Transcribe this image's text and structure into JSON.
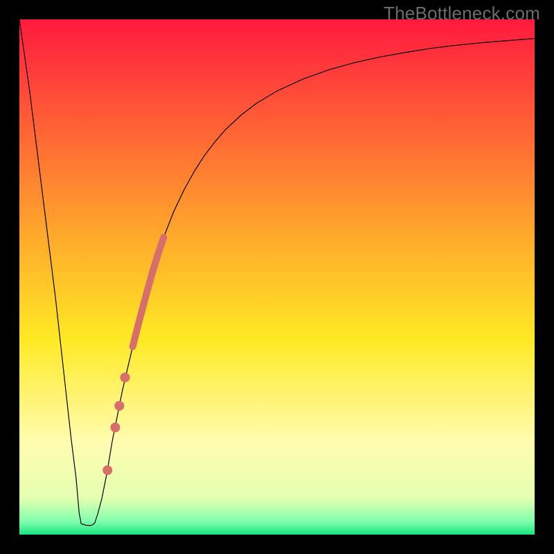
{
  "watermark": "TheBottleneck.com",
  "chart_data": {
    "type": "line",
    "title": "",
    "xlabel": "",
    "ylabel": "",
    "xlim": [
      0,
      100
    ],
    "ylim": [
      0,
      100
    ],
    "grid": false,
    "background_gradient": {
      "stops": [
        {
          "offset": 0.0,
          "color": "#ff1a3f"
        },
        {
          "offset": 0.4,
          "color": "#ffa22c"
        },
        {
          "offset": 0.62,
          "color": "#ffe924"
        },
        {
          "offset": 0.82,
          "color": "#fffcb0"
        },
        {
          "offset": 0.93,
          "color": "#e4ffb0"
        },
        {
          "offset": 0.975,
          "color": "#7dffad"
        },
        {
          "offset": 1.0,
          "color": "#16e47f"
        }
      ]
    },
    "series": [
      {
        "name": "baseline",
        "type": "line",
        "color": "#000000",
        "width": 1.2,
        "points": [
          {
            "x": 0.0,
            "y": 100.0
          },
          {
            "x": 1.0,
            "y": 93.0
          },
          {
            "x": 2.0,
            "y": 86.0
          },
          {
            "x": 3.0,
            "y": 78.0
          },
          {
            "x": 4.0,
            "y": 70.0
          },
          {
            "x": 5.0,
            "y": 62.0
          },
          {
            "x": 6.0,
            "y": 54.0
          },
          {
            "x": 7.0,
            "y": 46.0
          },
          {
            "x": 8.0,
            "y": 37.0
          },
          {
            "x": 9.0,
            "y": 28.0
          },
          {
            "x": 10.0,
            "y": 19.0
          },
          {
            "x": 11.0,
            "y": 11.0
          },
          {
            "x": 11.6,
            "y": 4.2
          },
          {
            "x": 12.0,
            "y": 2.1
          },
          {
            "x": 13.0,
            "y": 1.8
          },
          {
            "x": 14.0,
            "y": 1.8
          },
          {
            "x": 14.6,
            "y": 2.2
          },
          {
            "x": 15.2,
            "y": 4.0
          },
          {
            "x": 16.0,
            "y": 7.0
          },
          {
            "x": 17.0,
            "y": 12.0
          },
          {
            "x": 18.0,
            "y": 18.0
          },
          {
            "x": 19.0,
            "y": 23.0
          },
          {
            "x": 20.0,
            "y": 28.0
          },
          {
            "x": 21.0,
            "y": 32.3
          },
          {
            "x": 22.0,
            "y": 36.5
          },
          {
            "x": 23.0,
            "y": 40.5
          },
          {
            "x": 24.0,
            "y": 44.3
          },
          {
            "x": 25.0,
            "y": 48.0
          },
          {
            "x": 26.0,
            "y": 51.5
          },
          {
            "x": 27.0,
            "y": 54.7
          },
          {
            "x": 28.0,
            "y": 57.7
          },
          {
            "x": 30.0,
            "y": 62.8
          },
          {
            "x": 32.0,
            "y": 67.0
          },
          {
            "x": 34.0,
            "y": 70.6
          },
          {
            "x": 36.0,
            "y": 73.7
          },
          {
            "x": 38.0,
            "y": 76.3
          },
          {
            "x": 40.0,
            "y": 78.6
          },
          {
            "x": 43.0,
            "y": 81.4
          },
          {
            "x": 46.0,
            "y": 83.7
          },
          {
            "x": 50.0,
            "y": 86.1
          },
          {
            "x": 55.0,
            "y": 88.4
          },
          {
            "x": 60.0,
            "y": 90.2
          },
          {
            "x": 65.0,
            "y": 91.6
          },
          {
            "x": 70.0,
            "y": 92.7
          },
          {
            "x": 75.0,
            "y": 93.6
          },
          {
            "x": 80.0,
            "y": 94.4
          },
          {
            "x": 85.0,
            "y": 95.0
          },
          {
            "x": 90.0,
            "y": 95.5
          },
          {
            "x": 95.0,
            "y": 95.9
          },
          {
            "x": 100.0,
            "y": 96.3
          }
        ]
      },
      {
        "name": "highlight-band",
        "type": "line",
        "color": "#d76e6a",
        "width": 10,
        "linecap": "round",
        "points": [
          {
            "x": 22.0,
            "y": 36.5
          },
          {
            "x": 23.0,
            "y": 40.5
          },
          {
            "x": 24.0,
            "y": 44.3
          },
          {
            "x": 25.0,
            "y": 48.0
          },
          {
            "x": 26.0,
            "y": 51.5
          },
          {
            "x": 27.0,
            "y": 54.7
          },
          {
            "x": 28.0,
            "y": 57.7
          }
        ]
      },
      {
        "name": "dots",
        "type": "scatter",
        "color": "#d76e6a",
        "radius": 7,
        "points": [
          {
            "x": 17.1,
            "y": 12.5
          },
          {
            "x": 18.6,
            "y": 20.8
          },
          {
            "x": 19.4,
            "y": 25.0
          },
          {
            "x": 20.5,
            "y": 30.5
          }
        ]
      }
    ]
  }
}
